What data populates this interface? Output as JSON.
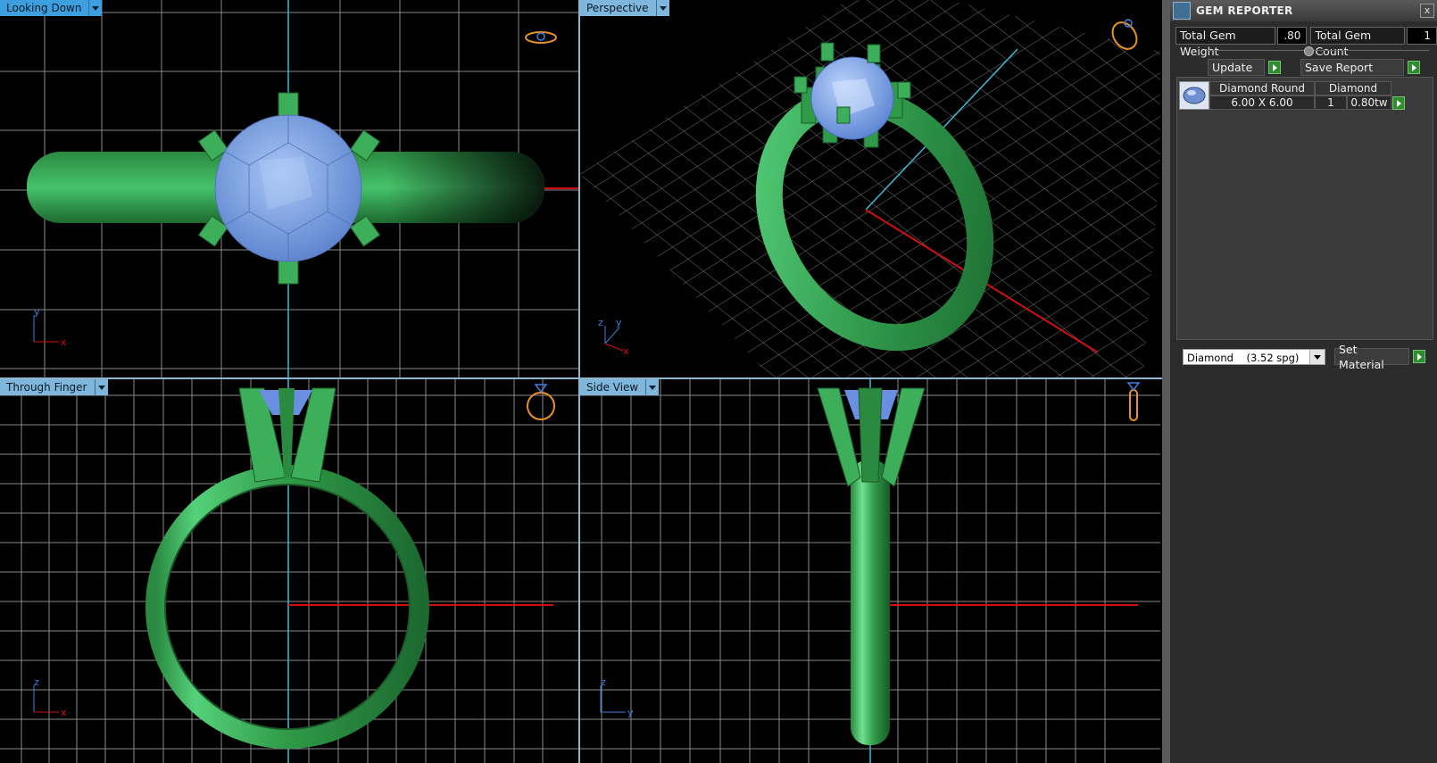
{
  "viewports": {
    "top_left": {
      "label": "Looking Down"
    },
    "top_right": {
      "label": "Perspective"
    },
    "bottom_left": {
      "label": "Through Finger"
    },
    "bottom_right": {
      "label": "Side View"
    }
  },
  "axes": {
    "top_left": {
      "a": "y",
      "b": "x"
    },
    "top_right": {
      "a": "z",
      "b": "y",
      "c": "x"
    },
    "bottom_left": {
      "a": "z",
      "b": "x"
    },
    "bottom_right": {
      "a": "z",
      "b": "y"
    }
  },
  "panel": {
    "title": "GEM REPORTER",
    "close": "x",
    "total_weight_label": "Total Gem Weight",
    "total_weight_value": ".80",
    "total_count_label": "Total Gem Count",
    "total_count_value": "1",
    "update_label": "Update",
    "save_report_label": "Save Report",
    "gem": {
      "name": "Diamond Round",
      "size": "6.00 X 6.00",
      "material": "Diamond",
      "count": "1",
      "weight": "0.80tw"
    },
    "material_select": "Diamond    (3.52 spg)",
    "set_material_label": "Set Material"
  },
  "colors": {
    "metal": "#3dae5a",
    "stone": "#7fa6e8",
    "grid": "#8a8a8a",
    "axis_red": "#d01010",
    "axis_cyan": "#3fb8d8",
    "active_tab": "#3e9fe0"
  }
}
